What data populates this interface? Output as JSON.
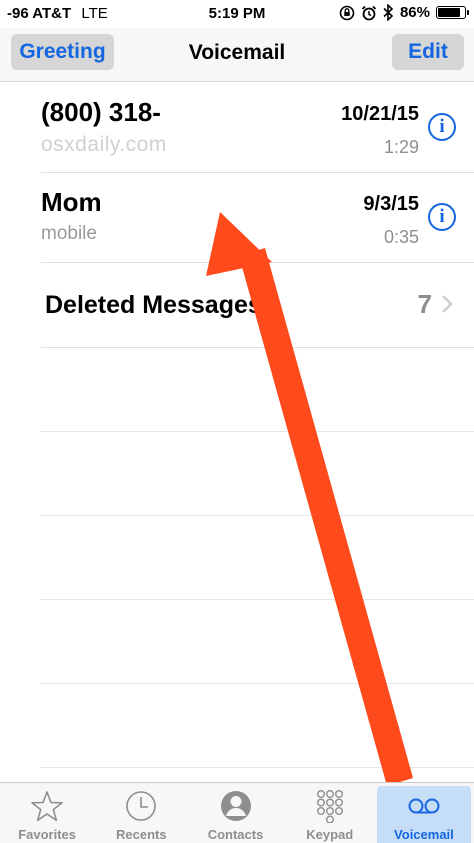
{
  "status_bar": {
    "carrier": "-96 AT&T",
    "network": "LTE",
    "time": "5:19 PM",
    "battery": "86%",
    "battery_level": 0.86
  },
  "nav": {
    "left_button": "Greeting",
    "title": "Voicemail",
    "right_button": "Edit"
  },
  "voicemails": [
    {
      "name": "(800) 318-",
      "subtitle": "osxdaily.com",
      "date": "10/21/15",
      "duration": "1:29"
    },
    {
      "name": "Mom",
      "subtitle": "mobile",
      "date": "9/3/15",
      "duration": "0:35"
    }
  ],
  "deleted": {
    "label": "Deleted Messages",
    "count": "7"
  },
  "tabs": [
    {
      "label": "Favorites",
      "icon": "star-icon"
    },
    {
      "label": "Recents",
      "icon": "clock-icon"
    },
    {
      "label": "Contacts",
      "icon": "person-icon"
    },
    {
      "label": "Keypad",
      "icon": "keypad-icon"
    },
    {
      "label": "Voicemail",
      "icon": "voicemail-icon"
    }
  ],
  "colors": {
    "accent": "#1466e0",
    "arrow": "#ff4a1c",
    "active_tab_bg": "#c6ddf7"
  }
}
